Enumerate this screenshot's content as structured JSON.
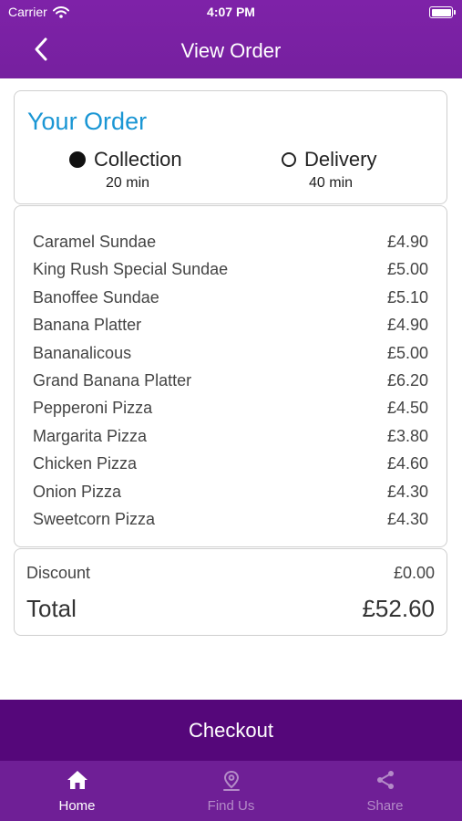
{
  "status": {
    "carrier": "Carrier",
    "time": "4:07 PM"
  },
  "nav": {
    "title": "View Order"
  },
  "order": {
    "title": "Your Order",
    "options": [
      {
        "label": "Collection",
        "time": "20 min",
        "selected": true
      },
      {
        "label": "Delivery",
        "time": "40 min",
        "selected": false
      }
    ]
  },
  "items": [
    {
      "name": "Caramel Sundae",
      "price": "£4.90"
    },
    {
      "name": "King Rush Special Sundae",
      "price": "£5.00"
    },
    {
      "name": "Banoffee Sundae",
      "price": "£5.10"
    },
    {
      "name": "Banana Platter",
      "price": "£4.90"
    },
    {
      "name": "Bananalicous",
      "price": "£5.00"
    },
    {
      "name": "Grand Banana Platter",
      "price": "£6.20"
    },
    {
      "name": "Pepperoni Pizza",
      "price": "£4.50"
    },
    {
      "name": "Margarita Pizza",
      "price": "£3.80"
    },
    {
      "name": "Chicken Pizza",
      "price": "£4.60"
    },
    {
      "name": "Onion Pizza",
      "price": "£4.30"
    },
    {
      "name": "Sweetcorn Pizza",
      "price": "£4.30"
    }
  ],
  "summary": {
    "discount_label": "Discount",
    "discount_value": "£0.00",
    "total_label": "Total",
    "total_value": "£52.60"
  },
  "checkout": {
    "label": "Checkout"
  },
  "tabs": [
    {
      "label": "Home",
      "icon": "home-icon",
      "active": true
    },
    {
      "label": "Find Us",
      "icon": "location-pin-icon",
      "active": false
    },
    {
      "label": "Share",
      "icon": "share-icon",
      "active": false
    }
  ],
  "colors": {
    "primary": "#7b1fa2",
    "checkout": "#55077a",
    "tabbar": "#6f1f96",
    "accent_blue": "#1a96d4"
  }
}
